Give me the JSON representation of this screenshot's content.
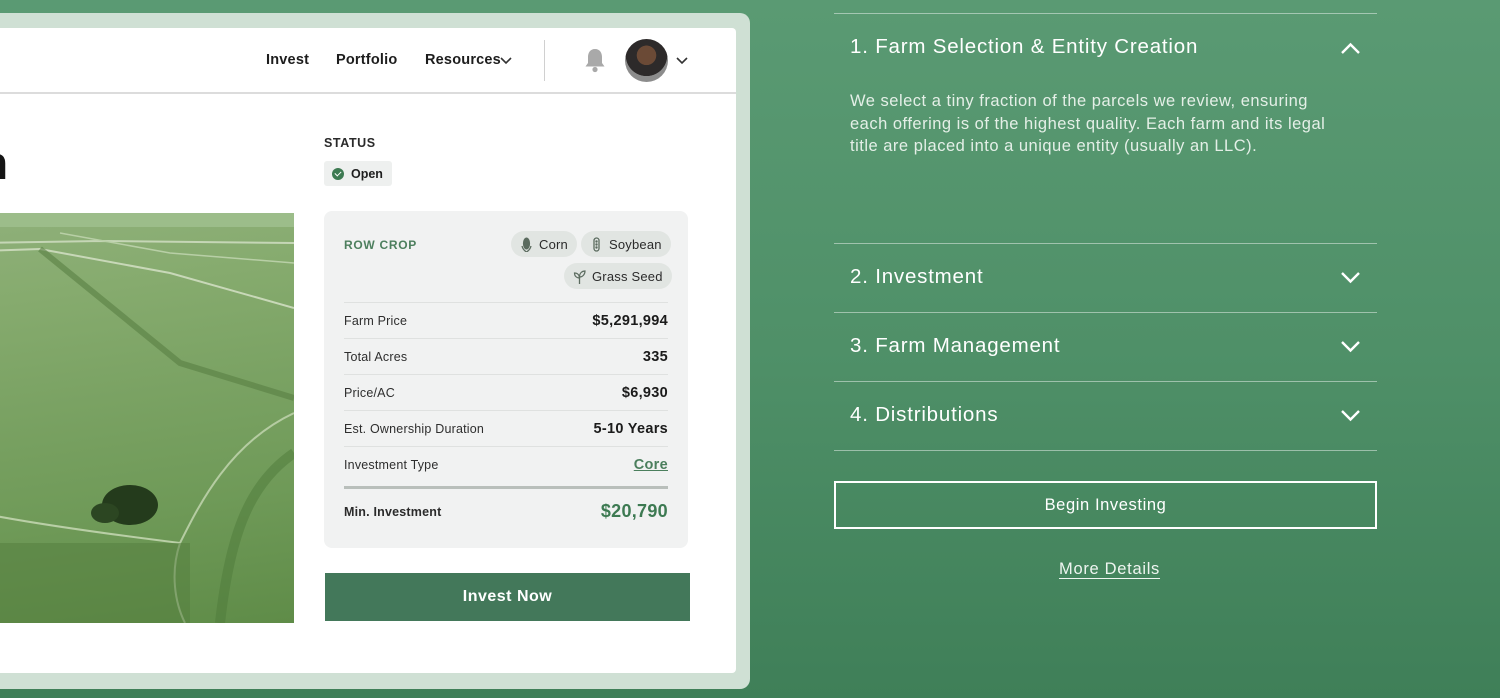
{
  "nav": {
    "links": [
      "Invest",
      "Portfolio",
      "Resources"
    ],
    "icons": [
      "chevron-down-icon",
      "bell-icon",
      "avatar",
      "chevron-down-icon"
    ]
  },
  "listing": {
    "title_fragment": "n",
    "status_label": "STATUS",
    "status_value": "Open",
    "crop_label": "ROW CROP",
    "crops": [
      "Corn",
      "Soybean",
      "Grass Seed"
    ],
    "details": [
      {
        "label": "Farm Price",
        "value": "$5,291,994"
      },
      {
        "label": "Total Acres",
        "value": "335"
      },
      {
        "label": "Price/AC",
        "value": "$6,930"
      },
      {
        "label": "Est. Ownership Duration",
        "value": "5-10 Years"
      },
      {
        "label": "Investment Type",
        "value": "Core"
      }
    ],
    "min_investment_label": "Min. Investment",
    "min_investment_value": "$20,790",
    "invest_button": "Invest Now"
  },
  "process": {
    "steps": [
      {
        "title": "1. Farm Selection & Entity Creation",
        "expanded": true,
        "body": "We select a tiny fraction of the parcels we review, ensuring each offering is of the highest quality. Each farm and its legal title are placed into a unique entity (usually an LLC)."
      },
      {
        "title": "2. Investment",
        "expanded": false
      },
      {
        "title": "3. Farm Management",
        "expanded": false
      },
      {
        "title": "4. Distributions",
        "expanded": false
      }
    ],
    "begin_button": "Begin Investing",
    "more_link": "More Details"
  },
  "colors": {
    "brand_green": "#43785a",
    "accent_green": "#3d7a52",
    "background_green": "#4f9068"
  }
}
